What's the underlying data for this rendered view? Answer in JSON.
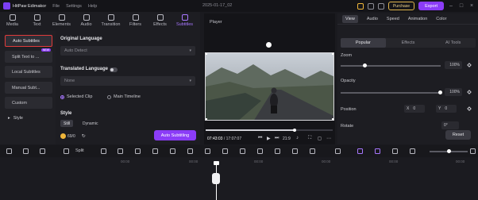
{
  "titlebar": {
    "app_name": "HitPaw Edimakor",
    "menu": [
      "File",
      "Settings",
      "Help"
    ],
    "title": "2025-01-17_02",
    "purchase_label": "Purchase",
    "export_label": "Export"
  },
  "toolbar": {
    "tabs": [
      "Media",
      "Text",
      "Elements",
      "Audio",
      "Transition",
      "Filters",
      "Effects",
      "Subtitles"
    ],
    "active": "Subtitles"
  },
  "left_nav": {
    "items": [
      "Auto Subtitles",
      "Split Text to ...",
      "Local Subtitles",
      "Manual Subt...",
      "Custom",
      "Style"
    ],
    "new_badge": "NEW"
  },
  "subtitles_panel": {
    "original_language_label": "Original Language",
    "original_language_value": "Auto Detect",
    "translated_language_label": "Translated Language",
    "translated_language_value": "None",
    "radio_options": [
      "Selected Clip",
      "Main Timeline"
    ],
    "style_label": "Style",
    "style_tabs": [
      "Still",
      "Dynamic"
    ],
    "credits": "69/0",
    "auto_button": "Auto Subtitling"
  },
  "player": {
    "label": "Player",
    "current_time": "07:43:03",
    "total_time": "17:07:07",
    "zoom": "21:9",
    "progress": 0.7
  },
  "properties": {
    "tabs": [
      "View",
      "Audio",
      "Speed",
      "Animation",
      "Color"
    ],
    "subtabs": [
      "Popular",
      "Effects",
      "AI Tools"
    ],
    "zoom_label": "Zoom",
    "zoom_value": "100",
    "zoom_unit": "%",
    "opacity_label": "Opacity",
    "opacity_value": "100",
    "opacity_unit": "%",
    "position_label": "Position",
    "x_label": "X",
    "x_value": "0",
    "y_label": "Y",
    "y_value": "0",
    "rotate_label": "Rotate",
    "rotate_value": "0°",
    "reset_label": "Reset"
  },
  "timeline": {
    "split_label": "Split",
    "ruler_labels": [
      "00:00",
      "00:00",
      "00:00",
      "00:00",
      "00:00",
      "00:00"
    ]
  },
  "colors": {
    "accent": "#8b3cf7",
    "active_outline": "#e03b3b"
  }
}
